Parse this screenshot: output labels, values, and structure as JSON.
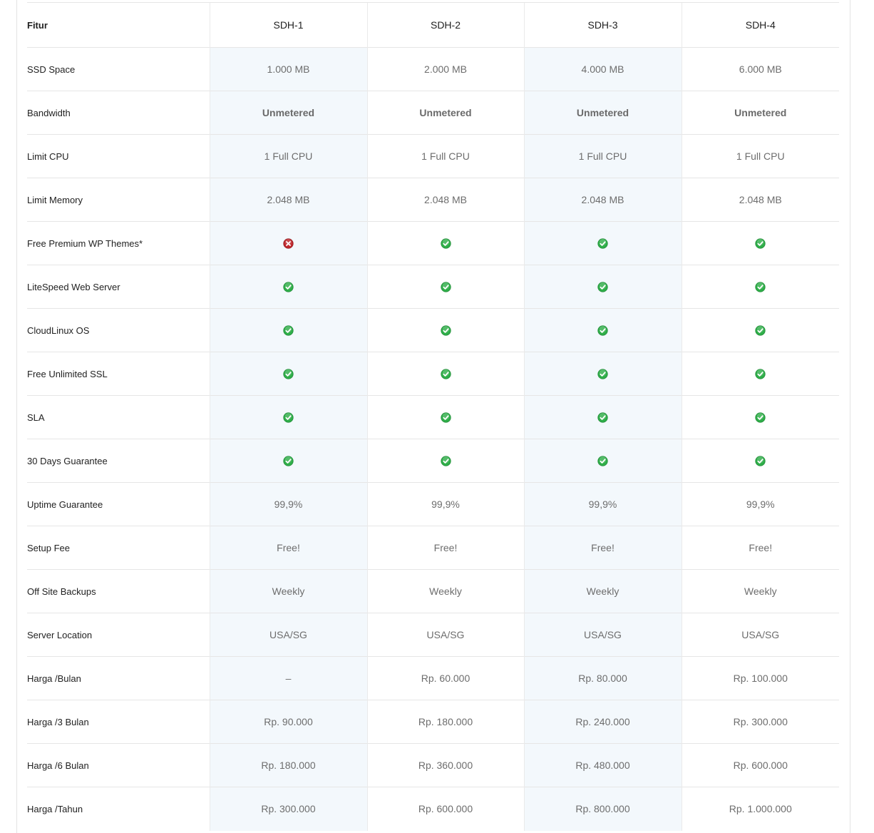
{
  "table": {
    "header_label": "Fitur",
    "plans": [
      "SDH-1",
      "SDH-2",
      "SDH-3",
      "SDH-4"
    ],
    "rows": [
      {
        "label": "SSD Space",
        "type": "text",
        "values": [
          "1.000 MB",
          "2.000 MB",
          "4.000 MB",
          "6.000 MB"
        ]
      },
      {
        "label": "Bandwidth",
        "type": "bold",
        "values": [
          "Unmetered",
          "Unmetered",
          "Unmetered",
          "Unmetered"
        ]
      },
      {
        "label": "Limit CPU",
        "type": "text",
        "values": [
          "1 Full CPU",
          "1 Full CPU",
          "1 Full CPU",
          "1 Full CPU"
        ]
      },
      {
        "label": "Limit Memory",
        "type": "text",
        "values": [
          "2.048 MB",
          "2.048 MB",
          "2.048 MB",
          "2.048 MB"
        ]
      },
      {
        "label": "Free Premium WP Themes*",
        "type": "icon",
        "values": [
          "cross-icon",
          "check-icon",
          "check-icon",
          "check-icon"
        ]
      },
      {
        "label": "LiteSpeed Web Server",
        "type": "icon",
        "values": [
          "check-icon",
          "check-icon",
          "check-icon",
          "check-icon"
        ]
      },
      {
        "label": "CloudLinux OS",
        "type": "icon",
        "values": [
          "check-icon",
          "check-icon",
          "check-icon",
          "check-icon"
        ]
      },
      {
        "label": "Free Unlimited SSL",
        "type": "icon",
        "values": [
          "check-icon",
          "check-icon",
          "check-icon",
          "check-icon"
        ]
      },
      {
        "label": "SLA",
        "type": "icon",
        "values": [
          "check-icon",
          "check-icon",
          "check-icon",
          "check-icon"
        ]
      },
      {
        "label": "30 Days Guarantee",
        "type": "icon",
        "values": [
          "check-icon",
          "check-icon",
          "check-icon",
          "check-icon"
        ]
      },
      {
        "label": "Uptime Guarantee",
        "type": "text",
        "values": [
          "99,9%",
          "99,9%",
          "99,9%",
          "99,9%"
        ]
      },
      {
        "label": "Setup Fee",
        "type": "text",
        "values": [
          "Free!",
          "Free!",
          "Free!",
          "Free!"
        ]
      },
      {
        "label": "Off Site Backups",
        "type": "text",
        "values": [
          "Weekly",
          "Weekly",
          "Weekly",
          "Weekly"
        ]
      },
      {
        "label": "Server Location",
        "type": "text",
        "values": [
          "USA/SG",
          "USA/SG",
          "USA/SG",
          "USA/SG"
        ]
      },
      {
        "label": "Harga /Bulan",
        "type": "text",
        "values": [
          "–",
          "Rp. 60.000",
          "Rp. 80.000",
          "Rp. 100.000"
        ]
      },
      {
        "label": "Harga /3 Bulan",
        "type": "text",
        "values": [
          "Rp. 90.000",
          "Rp. 180.000",
          "Rp. 240.000",
          "Rp. 300.000"
        ]
      },
      {
        "label": "Harga /6 Bulan",
        "type": "text",
        "values": [
          "Rp. 180.000",
          "Rp. 360.000",
          "Rp. 480.000",
          "Rp. 600.000"
        ]
      },
      {
        "label": "Harga /Tahun",
        "type": "text",
        "values": [
          "Rp. 300.000",
          "Rp. 600.000",
          "Rp. 800.000",
          "Rp. 1.000.000"
        ]
      }
    ]
  },
  "colors": {
    "shade": "#f3f8fc",
    "check": "#2fae49",
    "cross": "#c0282d"
  }
}
